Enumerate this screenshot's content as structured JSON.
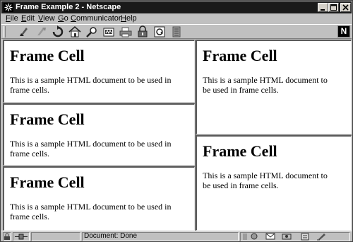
{
  "window": {
    "title": "Frame Example 2 - Netscape"
  },
  "menu": {
    "items": [
      {
        "first": "F",
        "rest": "ile"
      },
      {
        "first": "E",
        "rest": "dit"
      },
      {
        "first": "V",
        "rest": "iew"
      },
      {
        "first": "G",
        "rest": "o"
      },
      {
        "first": "C",
        "rest": "ommunicator"
      },
      {
        "first": "H",
        "rest": "elp"
      }
    ]
  },
  "toolbar": {
    "icons": [
      "back-icon",
      "forward-icon",
      "reload-icon",
      "home-icon",
      "search-icon",
      "netscape-guide-icon",
      "print-icon",
      "security-icon",
      "shop-icon",
      "stop-icon"
    ],
    "logo": "N"
  },
  "frames": [
    {
      "heading": "Frame Cell",
      "text": "This is a sample HTML document to be used in frame cells."
    },
    {
      "heading": "Frame Cell",
      "text": "This is a sample HTML document to be used in frame cells."
    },
    {
      "heading": "Frame Cell",
      "text": "This is a sample HTML document to be used in frame cells."
    },
    {
      "heading": "Frame Cell",
      "text": "This is a sample HTML document to be used in frame cells."
    },
    {
      "heading": "Frame Cell",
      "text": "This is a sample HTML document to be used in frame cells."
    }
  ],
  "status": {
    "text": "Document: Done"
  }
}
